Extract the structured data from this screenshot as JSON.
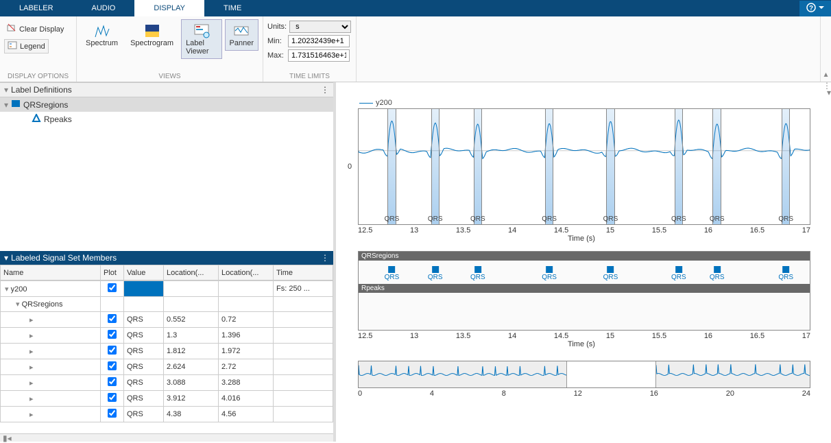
{
  "tabs": [
    "LABELER",
    "AUDIO",
    "DISPLAY",
    "TIME"
  ],
  "active_tab": "DISPLAY",
  "sections": {
    "display_options": {
      "label": "DISPLAY OPTIONS",
      "clear": "Clear Display",
      "legend": "Legend"
    },
    "views": {
      "label": "VIEWS",
      "spectrum": "Spectrum",
      "spectrogram": "Spectrogram",
      "labelviewer": "Label Viewer",
      "panner": "Panner"
    },
    "time_limits": {
      "label": "TIME LIMITS",
      "units_lbl": "Units:",
      "units_val": "s",
      "min_lbl": "Min:",
      "min_val": "1.20232439e+1",
      "max_lbl": "Max:",
      "max_val": "1.731516463e+1"
    }
  },
  "defs_panel_title": "Label Definitions",
  "defs": [
    {
      "name": "QRSregions",
      "kind": "roi"
    },
    {
      "name": "Rpeaks",
      "kind": "point"
    }
  ],
  "members_panel_title": "Labeled Signal Set Members",
  "columns": [
    "Name",
    "Plot",
    "Value",
    "Location(...",
    "Location(...",
    "Time"
  ],
  "signal_row": {
    "name": "y200",
    "time": "Fs: 250 ..."
  },
  "sublabel_row": {
    "name": "QRSregions"
  },
  "rows": [
    {
      "value": "QRS",
      "min": "0.552",
      "max": "0.72"
    },
    {
      "value": "QRS",
      "min": "1.3",
      "max": "1.396"
    },
    {
      "value": "QRS",
      "min": "1.812",
      "max": "1.972"
    },
    {
      "value": "QRS",
      "min": "2.624",
      "max": "2.72"
    },
    {
      "value": "QRS",
      "min": "3.088",
      "max": "3.288"
    },
    {
      "value": "QRS",
      "min": "3.912",
      "max": "4.016"
    },
    {
      "value": "QRS",
      "min": "4.38",
      "max": "4.56"
    }
  ],
  "legend_name": "y200",
  "main_xlabel": "Time (s)",
  "main_ylabel0": "0",
  "ticks_main": [
    "12.5",
    "13",
    "13.5",
    "14",
    "14.5",
    "15",
    "15.5",
    "16",
    "16.5",
    "17"
  ],
  "label_tracks": {
    "qrs": "QRSregions",
    "rpk": "Rpeaks"
  },
  "track_marker_value": "QRS",
  "panner_ticks": [
    "0",
    "4",
    "8",
    "12",
    "16",
    "20",
    "24"
  ],
  "chart_data": {
    "signal_name": "y200",
    "sample_rate_hz": 250,
    "displayed_range_s": [
      12.02,
      17.32
    ],
    "full_range_s": [
      0,
      26
    ],
    "xlabel": "Time (s)",
    "ylim_approx": [
      -0.6,
      1.0
    ],
    "qrs_regions_visible": [
      {
        "tmin": 12.36,
        "tmax": 12.46,
        "label": "QRS"
      },
      {
        "tmin": 12.87,
        "tmax": 12.97,
        "label": "QRS"
      },
      {
        "tmin": 13.37,
        "tmax": 13.47,
        "label": "QRS"
      },
      {
        "tmin": 14.21,
        "tmax": 14.31,
        "label": "QRS"
      },
      {
        "tmin": 14.93,
        "tmax": 15.03,
        "label": "QRS"
      },
      {
        "tmin": 15.73,
        "tmax": 15.83,
        "label": "QRS"
      },
      {
        "tmin": 16.18,
        "tmax": 16.28,
        "label": "QRS"
      },
      {
        "tmin": 16.99,
        "tmax": 17.09,
        "label": "QRS"
      }
    ]
  }
}
